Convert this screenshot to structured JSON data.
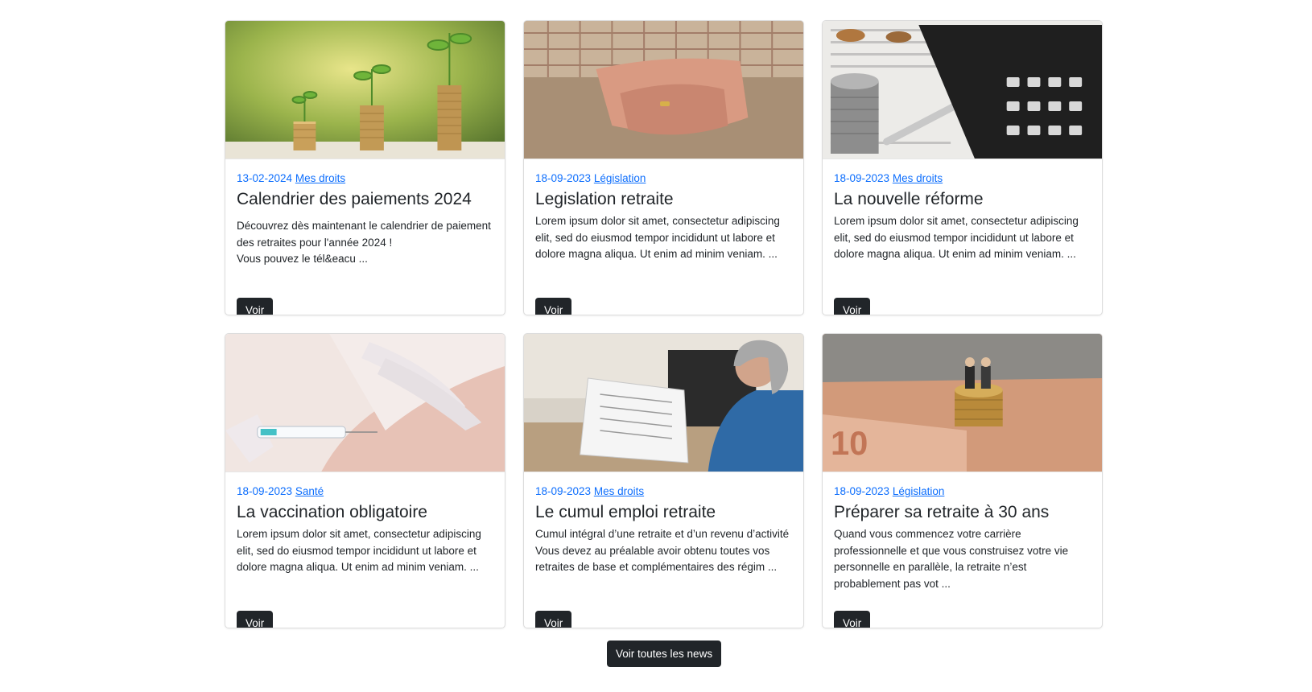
{
  "news": [
    {
      "date": "13-02-2024",
      "category": "Mes droits",
      "title": "Calendrier des paiements 2024",
      "excerpt": "Découvrez dès maintenant le calendrier de paiement des retraites pour l'année 2024 !\nVous pouvez le tél&eacu ...",
      "button": "Voir",
      "image": "plants-on-coin-stacks"
    },
    {
      "date": "18-09-2023",
      "category": "Législation",
      "title": "Legislation retraite",
      "excerpt": "Lorem ipsum dolor sit amet, consectetur adipiscing elit, sed do eiusmod tempor incididunt ut labore et dolore magna aliqua. Ut enim ad minim veniam. ...",
      "button": "Voir",
      "image": "elderly-hands"
    },
    {
      "date": "18-09-2023",
      "category": "Mes droits",
      "title": "La nouvelle réforme",
      "excerpt": "Lorem ipsum dolor sit amet, consectetur adipiscing elit, sed do eiusmod tempor incididunt ut labore et dolore magna aliqua. Ut enim ad minim veniam. ...",
      "button": "Voir",
      "image": "coins-and-calculator"
    },
    {
      "date": "18-09-2023",
      "category": "Santé",
      "title": "La vaccination obligatoire",
      "excerpt": "Lorem ipsum dolor sit amet, consectetur adipiscing elit, sed do eiusmod tempor incididunt ut labore et dolore magna aliqua. Ut enim ad minim veniam. ...",
      "button": "Voir",
      "image": "vaccination-syringe"
    },
    {
      "date": "18-09-2023",
      "category": "Mes droits",
      "title": "Le cumul emploi retraite",
      "excerpt": "Cumul intégral d’une retraite et d’un revenu d’activité Vous devez au préalable avoir obtenu toutes vos retraites de base et complémentaires des régim ...",
      "button": "Voir",
      "image": "woman-reading-document"
    },
    {
      "date": "18-09-2023",
      "category": "Législation",
      "title": "Préparer sa retraite à 30 ans",
      "excerpt": "Quand vous commencez votre carrière professionnelle et que vous construisez votre vie personnelle en parallèle, la retraite n’est probablement pas vot ...",
      "button": "Voir",
      "image": "couple-figurines-on-coins"
    }
  ],
  "all_news_button": "Voir toutes les news"
}
